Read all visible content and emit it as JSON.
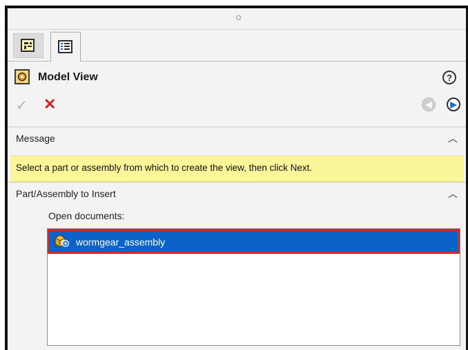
{
  "tabs": [
    {
      "name": "feature-manager",
      "icon": "feature-tree-icon"
    },
    {
      "name": "property-manager",
      "icon": "property-manager-icon"
    }
  ],
  "header": {
    "title": "Model View",
    "icon": "model-view-icon",
    "help_icon": "help-icon"
  },
  "actions": {
    "ok_glyph": "✓",
    "cancel_glyph": "✕",
    "back_glyph": "⇦",
    "next_glyph": "➜"
  },
  "message_section": {
    "title": "Message",
    "text": "Select a part or assembly from which to create the view, then click Next."
  },
  "insert_section": {
    "title": "Part/Assembly to Insert",
    "open_documents_label": "Open documents:",
    "documents": [
      {
        "label": "wormgear_assembly",
        "icon": "assembly-icon",
        "selected": true
      }
    ]
  },
  "colors": {
    "selection": "#0a63c9",
    "highlight_border": "#e0231b",
    "message_bg": "#fbf698",
    "cancel": "#d21f1f"
  }
}
